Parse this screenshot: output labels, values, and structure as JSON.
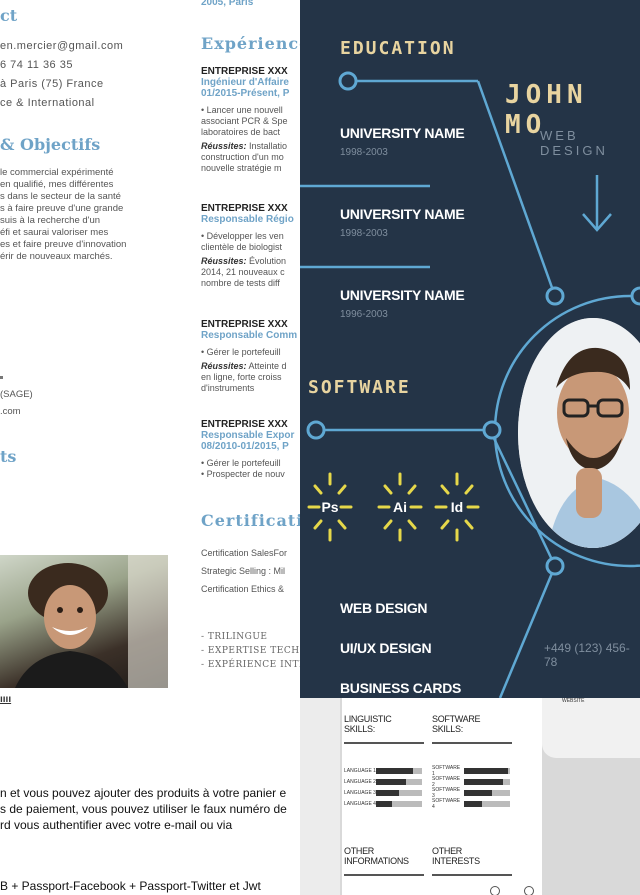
{
  "left_resume": {
    "contact_heading_fragment": "ct",
    "email": "en.mercier@gmail.com",
    "phone": "6 74 11 36 35",
    "location": "à Paris (75) France",
    "mobility": "ce & International",
    "objectives_heading": "& Objectifs",
    "objectives_lines": [
      "le commercial expérimenté",
      "en qualifié, mes différentes",
      "s dans le secteur de la santé",
      "s à faire preuve d'une grande",
      "suis à la recherche d'un",
      "éfi et saurai valoriser mes",
      "es et faire preuve d'innovation",
      "érir de nouveaux marchés."
    ],
    "software_fragment": "(SAGE)",
    "web_fragment": ".com",
    "interests_heading_fragment": "ts",
    "bottom_label": "ıııı"
  },
  "middle_resume": {
    "date_fragment": "2005, Paris",
    "experience_heading": "Expérience",
    "jobs": [
      {
        "company": "ENTREPRISE XXX",
        "role": "Ingénieur d'Affaire",
        "period": "01/2015-Présent, P",
        "desc": [
          "• Lancer une nouvell",
          "associant PCR & Spe",
          "laboratoires de bact"
        ],
        "ach_label": "Réussites:",
        "ach": [
          " Installatio",
          "construction d'un mo",
          "nouvelle stratégie m"
        ]
      },
      {
        "company": "ENTREPRISE XXX",
        "role": "Responsable Régio",
        "period": "",
        "desc": [
          "• Développer les ven",
          "clientèle de biologist"
        ],
        "ach_label": "Réussites:",
        "ach": [
          " Évolution",
          "2014, 21 nouveaux c",
          "nombre de tests diff"
        ]
      },
      {
        "company": "ENTREPRISE XXX",
        "role": "Responsable Comm",
        "period": "",
        "desc": [
          "• Gérer le portefeuill"
        ],
        "ach_label": "Réussites:",
        "ach": [
          " Atteinte d",
          "en ligne, forte croiss",
          "d'instruments"
        ]
      },
      {
        "company": "ENTREPRISE XXX",
        "role": "Responsable Expor",
        "period": "08/2010-01/2015, P",
        "desc": [
          "• Gérer le portefeuill",
          "• Prospecter de nouv"
        ],
        "ach_label": "",
        "ach": []
      }
    ],
    "certification_heading": "Certificatio",
    "certifications": [
      "Certification SalesFor",
      "Strategic Selling : Mil",
      "Certification Ethics &"
    ],
    "skills_list": [
      "- TRILINGUE",
      "- EXPERTISE TECH",
      "- EXPÉRIENCE INTI"
    ]
  },
  "dark_resume": {
    "education_heading": "EDUCATION",
    "name": "JOHN MO",
    "subtitle": "WEB DESIGN",
    "universities": [
      {
        "name": "UNIVERSITY NAME",
        "years": "1998-2003"
      },
      {
        "name": "UNIVERSITY NAME",
        "years": "1998-2003"
      },
      {
        "name": "UNIVERSITY NAME",
        "years": "1996-2003"
      }
    ],
    "software_heading": "SOFTWARE",
    "software_icons": [
      "Ps",
      "Ai",
      "Id"
    ],
    "skills": [
      "WEB DESIGN",
      "UI/UX DESIGN",
      "BUSINESS CARDS"
    ],
    "phone": "+449 (123) 456-78",
    "colors": {
      "background": "#243447",
      "accent": "#e8d4a0",
      "line": "#5fa8d3",
      "icon": "#e6d84a"
    }
  },
  "bottom_text": {
    "lines": [
      "n et vous pouvez ajouter des produits à votre panier e",
      "s de paiement, vous pouvez utiliser le faux numéro de",
      "rd vous authentifier avec votre e-mail ou via"
    ],
    "footer": "B + Passport-Facebook + Passport-Twitter et Jwt"
  },
  "doc_resume": {
    "linguistic_label": "LINGUISTIC SKILLS:",
    "software_label": "SOFTWARE SKILLS:",
    "languages": [
      "LANGUAGE 1",
      "LANGUAGE 2",
      "LANGUAGE 3",
      "LANGUAGE 4"
    ],
    "software_items": [
      "SOFTWARE 1",
      "SOFTWARE 2",
      "SOFTWARE 3",
      "SOFTWARE 4"
    ],
    "language_levels": [
      0.8,
      0.65,
      0.5,
      0.35
    ],
    "software_levels": [
      0.95,
      0.85,
      0.6,
      0.4
    ],
    "other_info_label": "OTHER INFORMATIONS",
    "other_interests_label": "OTHER INTERESTS",
    "website_fragment": "WEBSITE"
  }
}
